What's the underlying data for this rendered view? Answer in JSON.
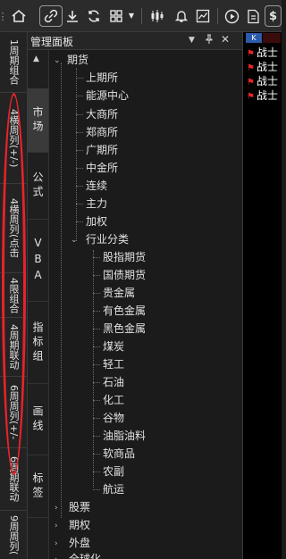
{
  "panel": {
    "title": "管理面板"
  },
  "side_tabs": [
    "1周期组合",
    "4横周列(+/-)",
    "4横周列(点击",
    "4限组合",
    "4周期联动",
    "6周周列(+/-",
    "6周期联动",
    "9周周列("
  ],
  "categories": [
    "市场",
    "公式",
    "VBA",
    "指标组",
    "画线",
    "标签"
  ],
  "tree": {
    "root": "期货",
    "exchanges": [
      "上期所",
      "能源中心",
      "大商所",
      "郑商所",
      "广期所",
      "中金所",
      "连续",
      "主力",
      "加权"
    ],
    "industry_label": "行业分类",
    "industries": [
      "股指期货",
      "国债期货",
      "贵金属",
      "有色金属",
      "黑色金属",
      "煤炭",
      "轻工",
      "石油",
      "化工",
      "谷物",
      "油脂油料",
      "软商品",
      "农副",
      "航运"
    ],
    "others": [
      "股票",
      "期权",
      "外盘",
      "全球化"
    ]
  },
  "right": {
    "badge": "K",
    "items": [
      "战士",
      "战士",
      "战士",
      "战士"
    ]
  },
  "colors": {
    "highlight_oval": "#e8232b",
    "background": "#1b1b1b",
    "accent_badge": "#2a5aa8"
  }
}
